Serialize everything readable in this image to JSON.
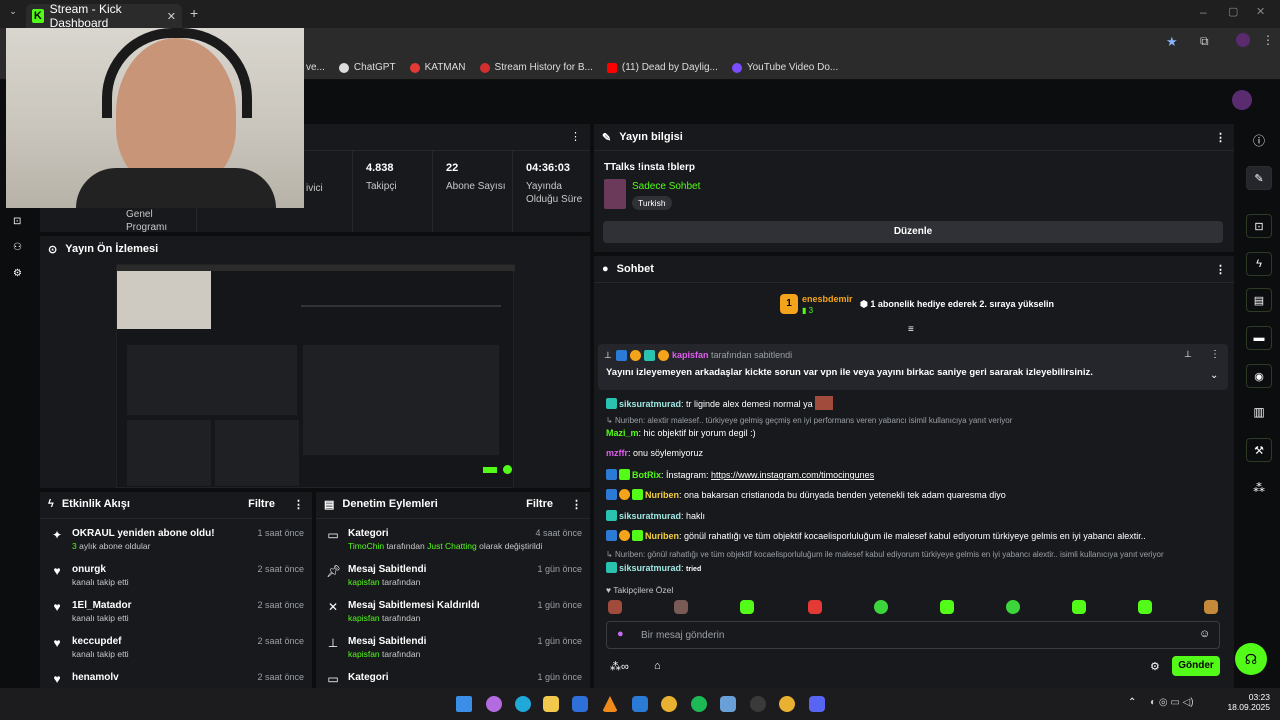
{
  "browser": {
    "tab_title": "Stream - Kick Dashboard",
    "bookmarks": [
      "ve...",
      "ChatGPT",
      "KATMAN",
      "Stream History for B...",
      "(11) Dead by Daylig...",
      "YouTube Video Do..."
    ]
  },
  "stats": {
    "partial_label_1": "ivici",
    "partial_label_2": "Genel Programı",
    "followers_value": "4.838",
    "followers_label": "Takipçi",
    "subs_value": "22",
    "subs_label": "Abone Sayısı",
    "uptime_value": "04:36:03",
    "uptime_label": "Yayında Olduğu Süre"
  },
  "preview": {
    "title": "Yayın Ön İzlemesi"
  },
  "activity": {
    "title": "Etkinlik Akışı",
    "filter": "Filtre",
    "items": [
      {
        "title": "OKRAUL yeniden abone oldu!",
        "sub_hl": "3",
        "sub": "aylık abone oldular",
        "time": "1 saat önce"
      },
      {
        "title": "onurgk",
        "sub": "kanalı takip etti",
        "time": "2 saat önce"
      },
      {
        "title": "1El_Matador",
        "sub": "kanalı takip etti",
        "time": "2 saat önce"
      },
      {
        "title": "keccupdef",
        "sub": "kanalı takip etti",
        "time": "2 saat önce"
      },
      {
        "title": "henamolv",
        "sub": "",
        "time": "2 saat önce"
      }
    ]
  },
  "moderation": {
    "title": "Denetim Eylemleri",
    "filter": "Filtre",
    "items": [
      {
        "title": "Kategori",
        "sub_hl": "TimoChin",
        "sub": "tarafından",
        "sub_hl2": "Just Chatting",
        "sub2": "olarak değiştirildi",
        "time": "4 saat önce"
      },
      {
        "title": "Mesaj Sabitlendi",
        "sub_hl": "kapisfan",
        "sub": "tarafından",
        "time": "1 gün önce"
      },
      {
        "title": "Mesaj Sabitlemesi Kaldırıldı",
        "sub_hl": "kapisfan",
        "sub": "tarafından",
        "time": "1 gün önce"
      },
      {
        "title": "Mesaj Sabitlendi",
        "sub_hl": "kapisfan",
        "sub": "tarafından",
        "time": "1 gün önce"
      },
      {
        "title": "Kategori",
        "time": "1 gün önce"
      }
    ]
  },
  "stream_info": {
    "header": "Yayın bilgisi",
    "title": "TTalks !insta !blerp",
    "category": "Sadece Sohbet",
    "language": "Turkish",
    "edit_button": "Düzenle"
  },
  "chat": {
    "header": "Sohbet",
    "gift_user": "enesbdemir",
    "gift_count": "3",
    "gift_text": "1 abonelik hediye ederek 2. sıraya yükselin",
    "pinned_by_user": "kapisfan",
    "pinned_by_text": "tarafından sabitlendi",
    "pinned_message": "Yayını izleyemeyen arkadaşlar kickte sorun var vpn ile veya yayını birkac saniye geri sararak izleyebilirsiniz.",
    "messages": [
      {
        "user": "siksuratmurad",
        "text": "tr liginde alex demesi normal ya",
        "color": "#9fe8e3"
      },
      {
        "reply": "Nuriben: alextir malesef.. türkiyeye gelmiş geçmiş en iyi performans veren yabancı isimil kullanıcıya yanıt veriyor"
      },
      {
        "user": "Mazi_m",
        "text": "hic objektif bir yorum degil :)",
        "color": "#53fc18"
      },
      {
        "user": "mzffr",
        "text": "onu söylemiyoruz",
        "color": "#e05cf0"
      },
      {
        "user": "BotRix",
        "text": "İnstagram: ",
        "link": "https://www.instagram.com/timocingunes",
        "color": "#53fc18"
      },
      {
        "user": "Nuriben",
        "text": "ona bakarsan cristianoda bu dünyada benden yetenekli tek adam quaresma diyo",
        "color": "#f4d03f"
      },
      {
        "user": "siksuratmurad",
        "text": "haklı",
        "color": "#9fe8e3"
      },
      {
        "user": "Nuriben",
        "text": "gönül rahatlığı ve tüm objektif kocaelisporluluğum ile malesef kabul ediyorum türkiyeye gelmis en iyi yabancı alextir..",
        "color": "#f4d03f"
      },
      {
        "reply": "Nuriben: gönül rahatlığı ve tüm objektif kocaelisporluluğum ile malesef kabul ediyorum türkiyeye gelmis en iyi yabancı alextir.. isimli kullanıcıya yanıt veriyor"
      },
      {
        "user": "siksuratmurad",
        "text": "",
        "emote": "tried",
        "color": "#9fe8e3"
      }
    ],
    "emote_section": "Takipçilere Özel",
    "input_placeholder": "Bir mesaj gönderin",
    "send_button": "Gönder"
  },
  "overlay": {
    "username": "siksuratmurad",
    "emote": "tried"
  },
  "taskbar": {
    "time": "03:23",
    "date": "18.09.2025"
  },
  "colors": {
    "accent": "#53fc18",
    "panel": "#18191d",
    "background": "#0b0d0f"
  }
}
